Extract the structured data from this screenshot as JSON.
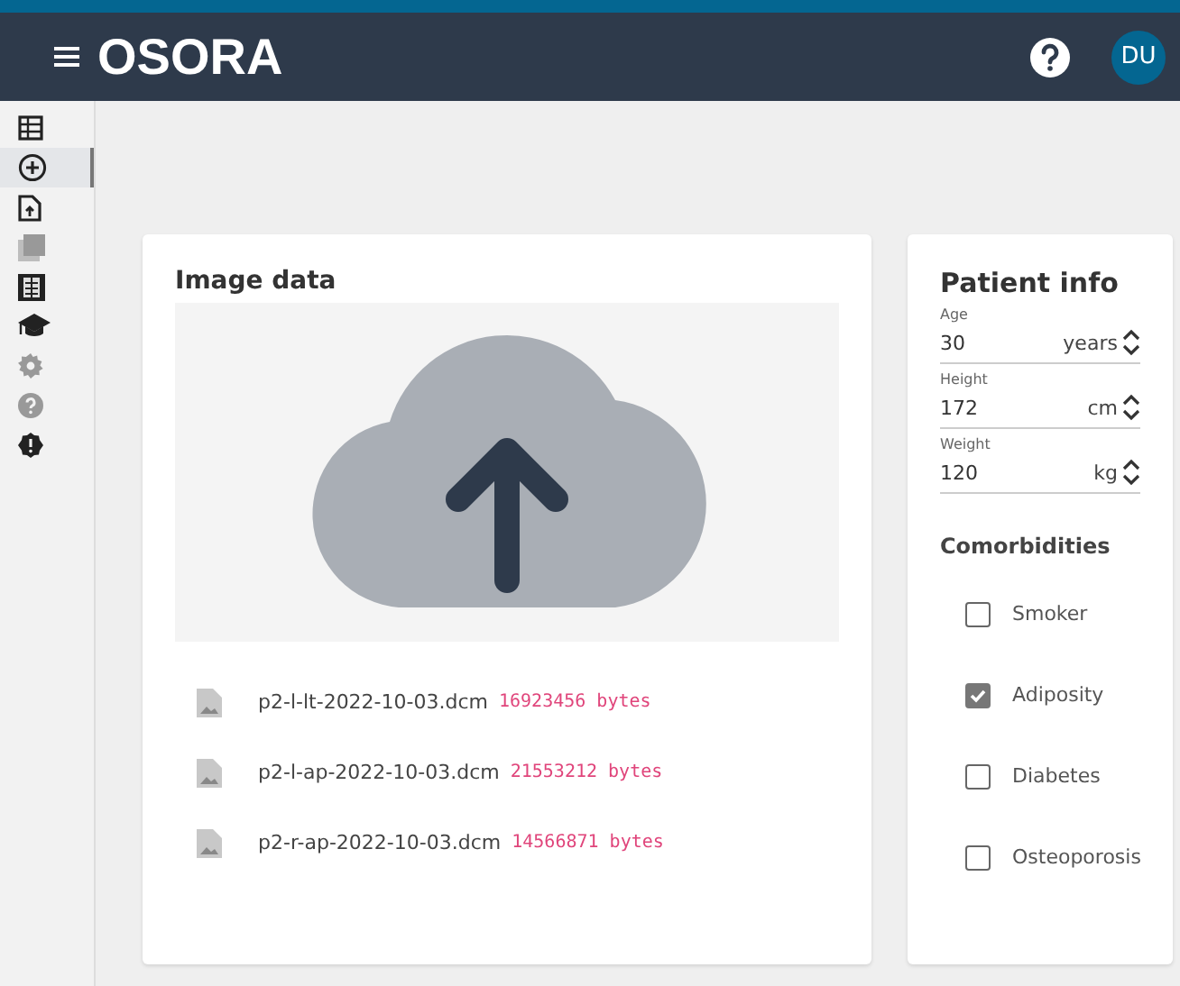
{
  "header": {
    "logo": "OSORA",
    "avatar": "DU"
  },
  "sidebar": {
    "items": [
      {
        "kind": "table",
        "selected": false,
        "disabled": false
      },
      {
        "kind": "add",
        "selected": true,
        "disabled": false
      },
      {
        "kind": "file",
        "selected": false,
        "disabled": false
      },
      {
        "kind": "images",
        "selected": false,
        "disabled": true
      },
      {
        "kind": "xray",
        "selected": false,
        "disabled": false
      },
      {
        "kind": "school",
        "selected": false,
        "disabled": false
      },
      {
        "kind": "gear",
        "selected": false,
        "disabled": true
      },
      {
        "kind": "help",
        "selected": false,
        "disabled": true
      },
      {
        "kind": "alert",
        "selected": false,
        "disabled": false
      }
    ]
  },
  "image_data": {
    "title": "Image data",
    "files": [
      {
        "name": "p2-l-lt-2022-10-03.dcm",
        "size": "16923456 bytes"
      },
      {
        "name": "p2-l-ap-2022-10-03.dcm",
        "size": "21553212 bytes"
      },
      {
        "name": "p2-r-ap-2022-10-03.dcm",
        "size": "14566871 bytes"
      }
    ]
  },
  "patient_info": {
    "title": "Patient info",
    "fields": [
      {
        "label": "Age",
        "value": "30",
        "unit": "years"
      },
      {
        "label": "Height",
        "value": "172",
        "unit": "cm"
      },
      {
        "label": "Weight",
        "value": "120",
        "unit": "kg"
      }
    ],
    "comorbidities_title": "Comorbidities",
    "comorbidities": [
      {
        "label": "Smoker",
        "checked": false
      },
      {
        "label": "Adiposity",
        "checked": true
      },
      {
        "label": "Diabetes",
        "checked": false
      },
      {
        "label": "Osteoporosis",
        "checked": false
      }
    ]
  }
}
